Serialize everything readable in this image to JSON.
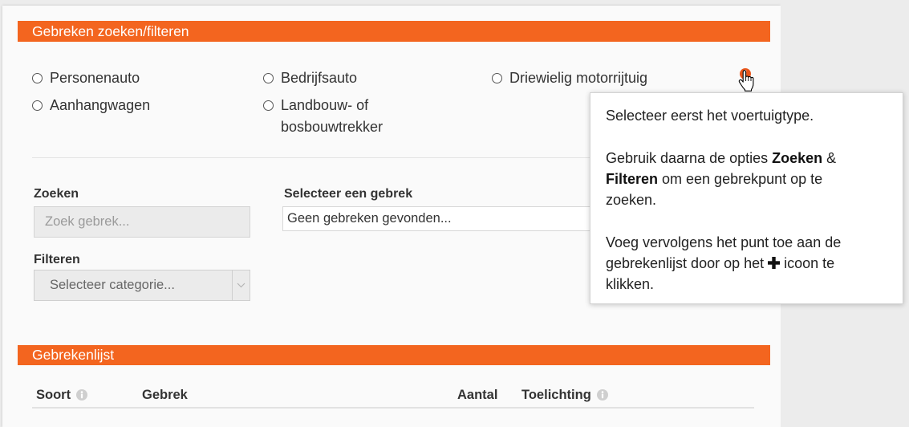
{
  "search_panel": {
    "title": "Gebreken zoeken/filteren",
    "info_icon": "info-icon",
    "vehicle_types": [
      {
        "label": "Personenauto",
        "selected": false
      },
      {
        "label": "Bedrijfsauto",
        "selected": false
      },
      {
        "label": "Driewielig motorrijtuig",
        "selected": false
      },
      {
        "label": "Aanhangwagen",
        "selected": false
      },
      {
        "label": "Landbouw- of bosbouwtrekker",
        "selected": false
      }
    ],
    "search": {
      "label": "Zoeken",
      "placeholder": "Zoek gebrek..."
    },
    "defect_select": {
      "label": "Selecteer een gebrek",
      "value": "Geen gebreken gevonden..."
    },
    "filter": {
      "label": "Filteren",
      "value": "Selecteer categorie...",
      "icon": "chevron-down-icon"
    }
  },
  "tooltip": {
    "paragraph_1": "Selecteer eerst het voertuigtype.",
    "paragraph_2": {
      "text_1": "Gebruik daarna de opties ",
      "bold_1": "Zoeken",
      "text_2": " & ",
      "bold_2": "Filteren",
      "text_3": " om een gebrekpunt op te zoeken."
    },
    "paragraph_3": {
      "text_1": "Voeg vervolgens het punt toe aan de gebrekenlijst door op het ",
      "icon": "plus-icon",
      "text_2": " icoon te klikken."
    }
  },
  "defect_list": {
    "title": "Gebrekenlijst",
    "columns": [
      {
        "label": "Soort",
        "icon": "info-icon"
      },
      {
        "label": "Gebrek"
      },
      {
        "label": "Aantal"
      },
      {
        "label": "Toelichting",
        "icon": "info-icon"
      }
    ]
  },
  "cursor": "hand-pointer-icon",
  "colors": {
    "accent": "#f3651f",
    "info_icon": "#e8561c",
    "info_icon_muted": "#cfcfcf",
    "panel_background": "#fafafa",
    "page_background": "#ececec",
    "text": "#333333"
  }
}
